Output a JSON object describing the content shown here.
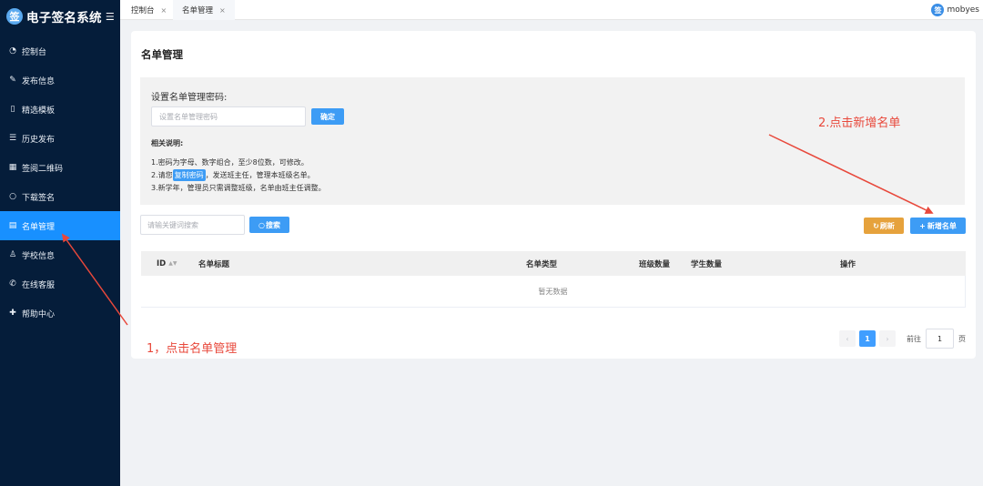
{
  "app": {
    "title": "电子签名系统",
    "logo_char": "签",
    "fold_icon": "menu-fold-icon"
  },
  "sidebar": {
    "items": [
      {
        "label": "控制台",
        "icon": "dashboard-icon",
        "glyph": "◔"
      },
      {
        "label": "发布信息",
        "icon": "edit-icon",
        "glyph": "✎"
      },
      {
        "label": "精选模板",
        "icon": "template-icon",
        "glyph": "▯"
      },
      {
        "label": "历史发布",
        "icon": "history-icon",
        "glyph": "☰"
      },
      {
        "label": "签阅二维码",
        "icon": "qrcode-icon",
        "glyph": "▦"
      },
      {
        "label": "下载签名",
        "icon": "download-icon",
        "glyph": "○"
      },
      {
        "label": "名单管理",
        "icon": "list-icon",
        "glyph": "▤",
        "active": true
      },
      {
        "label": "学校信息",
        "icon": "user-icon",
        "glyph": "♙"
      },
      {
        "label": "在线客服",
        "icon": "phone-icon",
        "glyph": "✆"
      },
      {
        "label": "帮助中心",
        "icon": "wrench-icon",
        "glyph": "✚"
      }
    ]
  },
  "tabs": [
    {
      "label": "控制台",
      "close": "×"
    },
    {
      "label": "名单管理",
      "close": "×",
      "active": true
    }
  ],
  "user": {
    "avatar_char": "签",
    "name": "mobyes"
  },
  "page": {
    "title": "名单管理",
    "password": {
      "label": "设置名单管理密码:",
      "placeholder": "设置名单管理密码",
      "confirm": "确定"
    },
    "notes": {
      "title": "相关说明:",
      "line1": "1.密码为字母、数字组合，至少8位数，可修改。",
      "line2_prefix": "2.请您",
      "line2_chip": "复制密码",
      "line2_suffix": "，发送班主任，管理本班级名单。",
      "line3": "3.新学年，管理员只需调整班级，名单由班主任调整。"
    },
    "search": {
      "placeholder": "请输关键词搜索",
      "button": "搜索",
      "icon": "search-icon"
    },
    "refresh_button": "刷新",
    "refresh_icon": "refresh-icon",
    "add_button": "新增名单",
    "add_icon": "plus-icon",
    "table": {
      "columns": [
        "ID",
        "名单标题",
        "名单类型",
        "班级数量",
        "学生数量",
        "操作"
      ],
      "empty": "暂无数据"
    },
    "pagination": {
      "prev": "‹",
      "current": "1",
      "next": "›",
      "goto_label": "前往",
      "goto_value": "1",
      "page_unit": "页"
    }
  },
  "annotations": {
    "step1": "1，点击名单管理",
    "step2": "2.点击新增名单",
    "color": "#e8483b"
  },
  "colors": {
    "sidebar_bg": "#051d3a",
    "active": "#1890ff",
    "primary": "#3d9cf5",
    "warning": "#e6a23c"
  }
}
